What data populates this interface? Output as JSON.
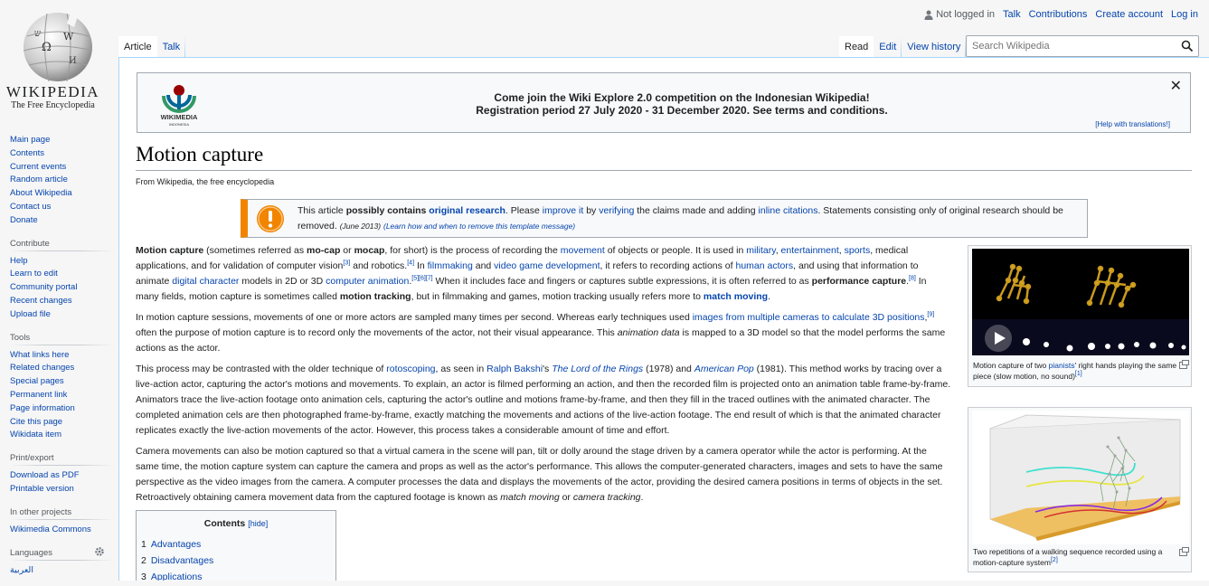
{
  "logo": {
    "wordmark": "WIKIPEDIA",
    "tagline": "The Free Encyclopedia"
  },
  "personal": {
    "not_logged_in": "Not logged in",
    "talk": "Talk",
    "contributions": "Contributions",
    "create_account": "Create account",
    "login": "Log in"
  },
  "tabs": {
    "article": "Article",
    "talk": "Talk",
    "read": "Read",
    "edit": "Edit",
    "history": "View history"
  },
  "search": {
    "placeholder": "Search Wikipedia"
  },
  "banner": {
    "org": "WIKIMEDIA",
    "org_sub": "INDONESIA",
    "line1": "Come join the Wiki Explore 2.0 competition on the Indonesian Wikipedia!",
    "line2": "Registration period 27 July 2020 - 31 December 2020. See terms and conditions.",
    "close": "✕",
    "help": "[Help with translations!]"
  },
  "article": {
    "title": "Motion capture",
    "site_sub": "From Wikipedia, the free encyclopedia"
  },
  "ambox": {
    "t1": "This article ",
    "t2": "possibly contains ",
    "t3": "original research",
    "t4": ". Please ",
    "t5": "improve it",
    "t6": " by ",
    "t7": "verifying",
    "t8": " the claims made and adding ",
    "t9": "inline citations",
    "t10": ". Statements consisting only of original research should be removed. ",
    "t11": "(June 2013)",
    "t12": " ",
    "t13": "(Learn how and when to remove this template message)"
  },
  "p1": {
    "a": "Motion capture",
    "b": " (sometimes referred as ",
    "c": "mo-cap",
    "d": " or ",
    "e": "mocap",
    "f": ", for short) is the process of recording the ",
    "g": "movement",
    "h": " of objects or people. It is used in ",
    "i": "military",
    "j": ", ",
    "k": "entertainment",
    "l": ", ",
    "m": "sports",
    "n": ", medical applications, and for validation of computer vision",
    "o": "[3]",
    "p": " and robotics.",
    "q": "[4]",
    "r": " In ",
    "s": "filmmaking",
    "t": " and ",
    "u": "video game development",
    "v": ", it refers to recording actions of ",
    "w": "human actors",
    "x": ", and using that information to animate ",
    "y": "digital character",
    "z": " models in 2D or 3D ",
    "aa": "computer animation",
    "ab": ".",
    "ac": "[5][6][7]",
    "ad": " When it includes face and fingers or captures subtle expressions, it is often referred to as ",
    "ae": "performance capture",
    "af": ".",
    "ag": "[8]",
    "ah": " In many fields, motion capture is sometimes called ",
    "ai": "motion tracking",
    "aj": ", but in filmmaking and games, motion tracking usually refers more to ",
    "ak": "match moving",
    "al": "."
  },
  "p2": {
    "a": "In motion capture sessions, movements of one or more actors are sampled many times per second. Whereas early techniques used ",
    "b": "images from multiple cameras to calculate 3D positions",
    "c": ",",
    "d": "[9]",
    "e": " often the purpose of motion capture is to record only the movements of the actor, not their visual appearance. This ",
    "f": "animation data",
    "g": " is mapped to a 3D model so that the model performs the same actions as the actor."
  },
  "p3": {
    "a": "This process may be contrasted with the older technique of ",
    "b": "rotoscoping",
    "c": ", as seen in ",
    "d": "Ralph Bakshi",
    "e": "'s ",
    "f": "The Lord of the Rings",
    "g": " (1978) and ",
    "h": "American Pop",
    "i": " (1981). This method works by tracing over a live-action actor, capturing the actor's motions and movements. To explain, an actor is filmed performing an action, and then the recorded film is projected onto an animation table frame-by-frame. Animators trace the live-action footage onto animation cels, capturing the actor's outline and motions frame-by-frame, and then they fill in the traced outlines with the animated character. The completed animation cels are then photographed frame-by-frame, exactly matching the movements and actions of the live-action footage. The end result of which is that the animated character replicates exactly the live-action movements of the actor. However, this process takes a considerable amount of time and effort."
  },
  "p4": {
    "a": "Camera movements can also be motion captured so that a virtual camera in the scene will pan, tilt or dolly around the stage driven by a camera operator while the actor is performing. At the same time, the motion capture system can capture the camera and props as well as the actor's performance. This allows the computer-generated characters, images and sets to have the same perspective as the video images from the camera. A computer processes the data and displays the movements of the actor, providing the desired camera positions in terms of objects in the set. Retroactively obtaining camera movement data from the captured footage is known as ",
    "b": "match moving",
    "c": " or ",
    "d": "camera tracking",
    "e": "."
  },
  "thumb1": {
    "cap_a": "Motion capture of two ",
    "cap_b": "pianists",
    "cap_c": "' right hands playing the same piece (slow motion, no sound)",
    "cap_d": "[1]"
  },
  "thumb2": {
    "cap_a": "Two repetitions of a walking sequence recorded using a motion-capture system",
    "cap_b": "[2]"
  },
  "toc": {
    "title": "Contents",
    "hide": "[hide]",
    "items": [
      {
        "num": "1",
        "label": "Advantages"
      },
      {
        "num": "2",
        "label": "Disadvantages"
      },
      {
        "num": "3",
        "label": "Applications"
      }
    ]
  },
  "sidebar": {
    "nav": [
      "Main page",
      "Contents",
      "Current events",
      "Random article",
      "About Wikipedia",
      "Contact us",
      "Donate"
    ],
    "contribute": {
      "heading": "Contribute",
      "items": [
        "Help",
        "Learn to edit",
        "Community portal",
        "Recent changes",
        "Upload file"
      ]
    },
    "tools": {
      "heading": "Tools",
      "items": [
        "What links here",
        "Related changes",
        "Special pages",
        "Permanent link",
        "Page information",
        "Cite this page",
        "Wikidata item"
      ]
    },
    "print": {
      "heading": "Print/export",
      "items": [
        "Download as PDF",
        "Printable version"
      ]
    },
    "other": {
      "heading": "In other projects",
      "items": [
        "Wikimedia Commons"
      ]
    },
    "languages": {
      "heading": "Languages",
      "items": [
        "العربية"
      ]
    }
  },
  "colors": {
    "link": "#0645ad",
    "ambox_border": "#f28500",
    "text": "#202122"
  }
}
